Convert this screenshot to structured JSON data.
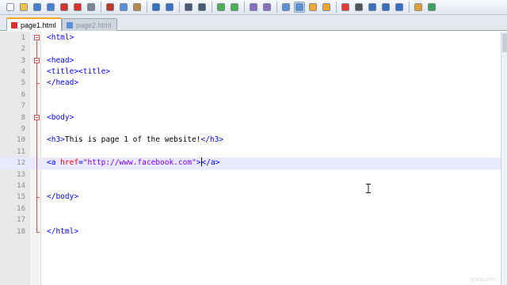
{
  "toolbar": {
    "buttons": [
      "new-file-icon",
      "open-file-icon",
      "save-icon",
      "save-all-icon",
      "close-icon",
      "close-all-icon",
      "print-icon",
      "cut-icon",
      "copy-icon",
      "paste-icon",
      "undo-icon",
      "redo-icon",
      "find-icon",
      "replace-icon",
      "zoom-in-icon",
      "zoom-out-icon",
      "sync-vertical-icon",
      "sync-horizontal-icon",
      "word-wrap-icon",
      "show-all-chars-icon",
      "indent-guide-icon",
      "user-language-icon",
      "record-macro-icon",
      "stop-record-icon",
      "playback-icon",
      "run-multiple-icon",
      "save-macro-icon",
      "launch-browser-icon",
      "spell-check-icon"
    ]
  },
  "tabs": [
    {
      "label": "page1.html",
      "active": true
    },
    {
      "label": "page2.html",
      "active": false
    }
  ],
  "editor": {
    "current_line": 12,
    "lines": [
      {
        "n": "1",
        "parts": [
          [
            "tag",
            "<html>"
          ]
        ]
      },
      {
        "n": "2",
        "parts": []
      },
      {
        "n": "3",
        "parts": [
          [
            "tag",
            "<head>"
          ]
        ]
      },
      {
        "n": "4",
        "parts": [
          [
            "tag",
            "<title><title>"
          ]
        ]
      },
      {
        "n": "5",
        "parts": [
          [
            "tag",
            "</head>"
          ]
        ]
      },
      {
        "n": "6",
        "parts": []
      },
      {
        "n": "7",
        "parts": []
      },
      {
        "n": "8",
        "parts": [
          [
            "tag",
            "<body>"
          ]
        ]
      },
      {
        "n": "9",
        "parts": []
      },
      {
        "n": "10",
        "parts": [
          [
            "tag",
            "<h3>"
          ],
          [
            "txt",
            "This is page 1 of the website!"
          ],
          [
            "tag",
            "</h3>"
          ]
        ]
      },
      {
        "n": "11",
        "parts": []
      },
      {
        "n": "12",
        "parts": [
          [
            "tag",
            "<a "
          ],
          [
            "attr",
            "href"
          ],
          [
            "tag",
            "="
          ],
          [
            "str",
            "\"http://www.facebook.com\""
          ],
          [
            "tag",
            ">"
          ],
          [
            "cursor",
            ""
          ],
          [
            "tag",
            "</a>"
          ]
        ]
      },
      {
        "n": "13",
        "parts": []
      },
      {
        "n": "14",
        "parts": []
      },
      {
        "n": "15",
        "parts": [
          [
            "tag",
            "</body>"
          ]
        ]
      },
      {
        "n": "16",
        "parts": []
      },
      {
        "n": "17",
        "parts": []
      },
      {
        "n": "18",
        "parts": [
          [
            "tag",
            "</html>"
          ]
        ]
      }
    ]
  },
  "watermark": "lynda.com"
}
